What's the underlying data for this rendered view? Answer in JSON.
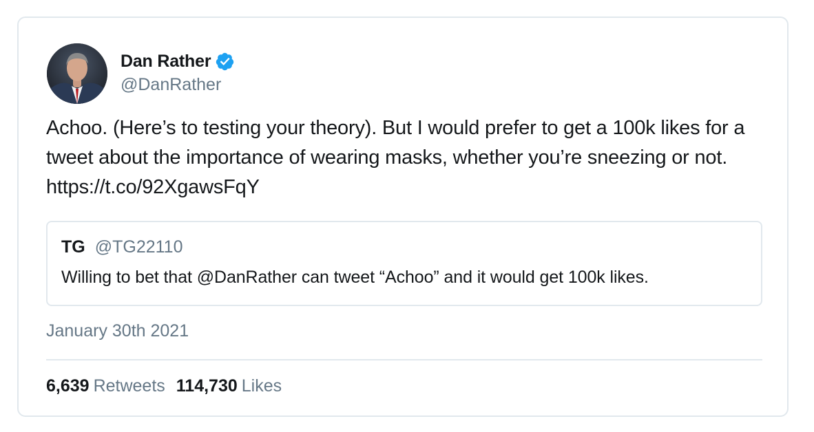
{
  "author": {
    "display_name": "Dan Rather",
    "handle": "@DanRather",
    "verified_icon": "verified-badge-icon",
    "avatar_icon": "profile-photo"
  },
  "tweet": {
    "text": "Achoo. (Here’s to testing your theory). But I would prefer to get a 100k likes for a tweet about the importance of wearing masks, whether you’re sneezing or not. https://t.co/92XgawsFqY",
    "date": "January 30th 2021"
  },
  "quoted_tweet": {
    "name": "TG",
    "handle": "@TG22110",
    "text": "Willing to bet that @DanRather can tweet “Achoo” and it would get 100k likes."
  },
  "stats": {
    "retweets_count": "6,639",
    "retweets_label": "Retweets",
    "likes_count": "114,730",
    "likes_label": "Likes"
  },
  "colors": {
    "primary_text": "#14171a",
    "secondary_text": "#657786",
    "border": "#e1e8ed",
    "verified_blue": "#1da1f2"
  }
}
